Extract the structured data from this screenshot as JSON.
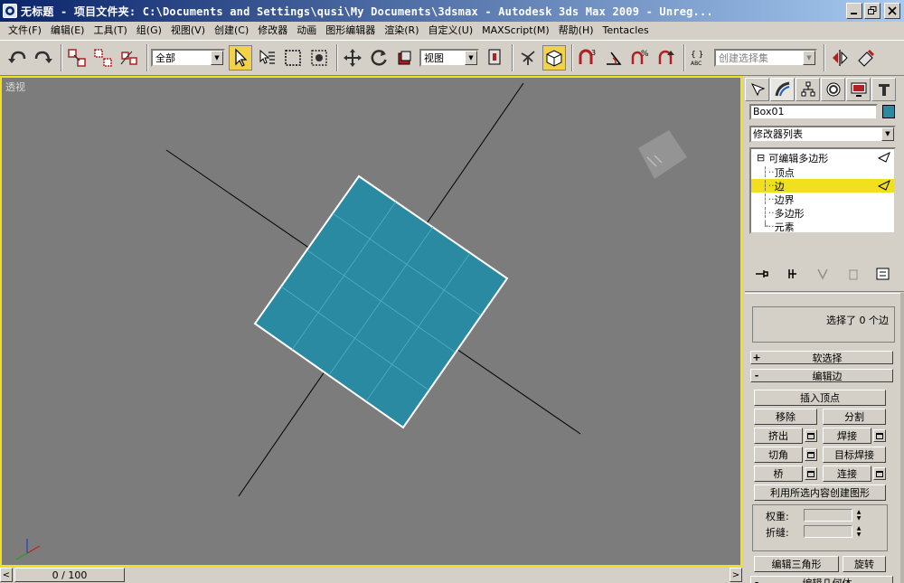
{
  "title_bar": {
    "app_icon": "3ds-max-icon",
    "title": "无标题    - 项目文件夹: C:\\Documents and Settings\\qusi\\My Documents\\3dsmax    - Autodesk 3ds Max  2009  - Unreg..."
  },
  "menu": [
    "文件(F)",
    "编辑(E)",
    "工具(T)",
    "组(G)",
    "视图(V)",
    "创建(C)",
    "修改器",
    "动画",
    "图形编辑器",
    "渲染(R)",
    "自定义(U)",
    "MAXScript(M)",
    "帮助(H)",
    "Tentacles"
  ],
  "toolbar": {
    "selection_filter": "全部",
    "coord_system": "视图",
    "named_selection_placeholder": "创建选择集",
    "icons": [
      "undo-icon",
      "redo-icon",
      "select-and-link-icon",
      "unlink-selection-icon",
      "bind-to-space-warp-icon",
      "select-object-icon",
      "select-by-name-icon",
      "rectangular-selection-region-icon",
      "window-crossing-icon",
      "select-and-move-icon",
      "select-and-rotate-icon",
      "select-and-scale-icon",
      "use-pivot-point-center-icon",
      "select-and-manipulate-icon",
      "keyboard-shortcut-override-icon",
      "snaps-toggle-icon",
      "angle-snap-icon",
      "percent-snap-icon",
      "spinner-snap-icon",
      "edit-named-selection-icon",
      "mirror-icon",
      "align-icon"
    ]
  },
  "viewport": {
    "label": "透视",
    "object_color": "#2a8aa2",
    "active_border_color": "#f0e020"
  },
  "time_slider": {
    "frame": "0 / 100",
    "prev_label": "<",
    "next_label": ">"
  },
  "command_panel": {
    "tabs": [
      "create-tab-icon",
      "modify-tab-icon",
      "hierarchy-tab-icon",
      "motion-tab-icon",
      "display-tab-icon",
      "utilities-tab-icon"
    ],
    "object_name": "Box01",
    "modifier_list": "修改器列表",
    "stack": {
      "root": "可编辑多边形",
      "expand": "⊟",
      "items": [
        "顶点",
        "边",
        "边界",
        "多边形",
        "元素"
      ],
      "selected_index": 1
    },
    "selection_info": "选择了 0 个边",
    "rollouts": {
      "soft_selection": "软选择",
      "soft_selection_sign": "+",
      "edit_edges": "编辑边",
      "edit_edges_sign": "-",
      "edit_geometry": "编辑几何体",
      "edit_geometry_sign": "-"
    },
    "edit_edge_buttons": {
      "insert_vertex": "插入顶点",
      "remove": "移除",
      "split": "分割",
      "extrude": "挤出",
      "weld": "焊接",
      "chamfer": "切角",
      "target_weld": "目标焊接",
      "bridge": "桥",
      "connect": "连接",
      "create_shape": "利用所选内容创建图形",
      "weight_label": "权重:",
      "crease_label": "折缝:",
      "edit_triangulation": "编辑三角形",
      "turn": "旋转"
    }
  }
}
